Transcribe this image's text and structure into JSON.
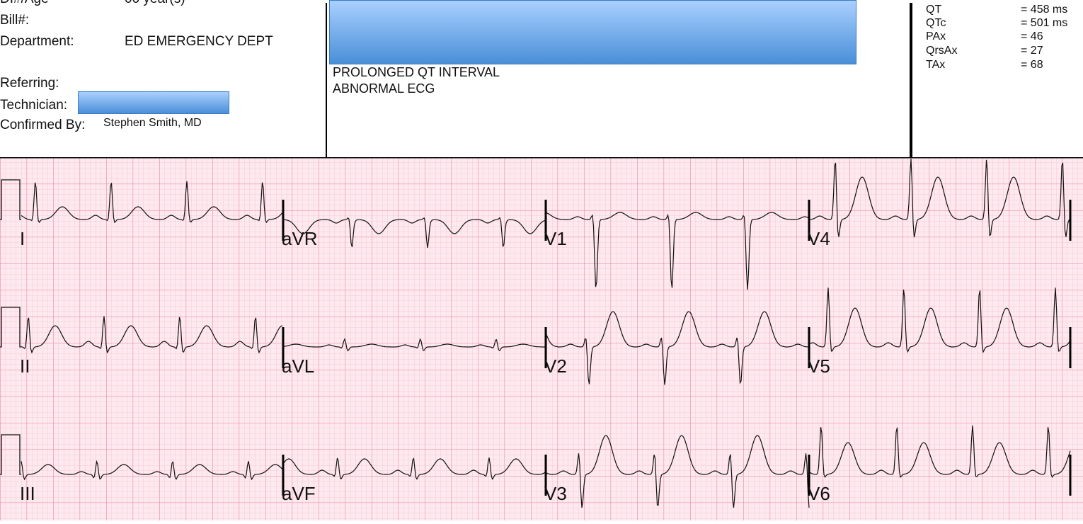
{
  "header": {
    "truncated_top_left": "DI#/Age",
    "truncated_top_mid": "00 year(s)",
    "bill_label": "Bill#:",
    "department_label": "Department:",
    "department_value": "ED EMERGENCY DEPT",
    "referring_label": "Referring:",
    "technician_label": "Technician:",
    "confirmed_label": "Confirmed By:",
    "confirmed_value": "Stephen Smith, MD"
  },
  "interpretation": {
    "lines": [
      "PROLONGED QT INTERVAL",
      "ABNORMAL ECG"
    ]
  },
  "measurements": [
    {
      "name": "QT",
      "value": "= 458 ms"
    },
    {
      "name": "QTc",
      "value": "= 501 ms"
    },
    {
      "name": "PAx",
      "value": "= 46"
    },
    {
      "name": "QrsAx",
      "value": "= 27"
    },
    {
      "name": "TAx",
      "value": "= 68"
    }
  ],
  "colors": {
    "grid_minor": "#f7c6d2",
    "grid_major": "#ef8fa8",
    "paper": "#fde8ee",
    "trace": "#111111",
    "redaction": "#6aa6e6"
  },
  "leads": [
    [
      "I",
      "aVR",
      "V1",
      "V4"
    ],
    [
      "II",
      "aVL",
      "V2",
      "V5"
    ],
    [
      "III",
      "aVF",
      "V3",
      "V6"
    ]
  ]
}
